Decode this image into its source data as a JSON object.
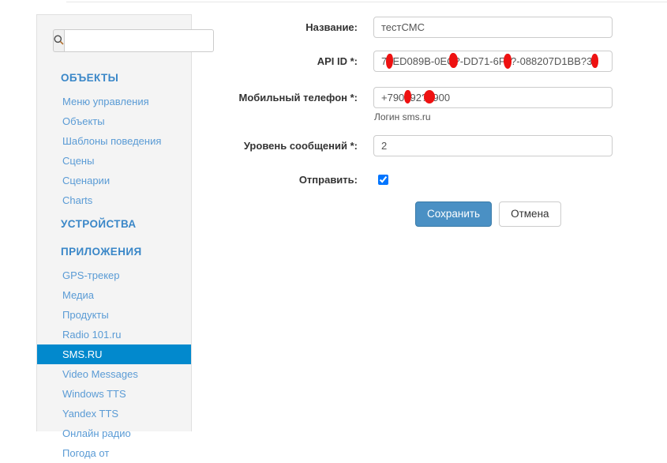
{
  "sidebar": {
    "search": {
      "value": "",
      "placeholder": "",
      "icon": "search-icon"
    },
    "sections": [
      {
        "label": "ОБЪЕКТЫ",
        "items": [
          {
            "label": "Меню управления",
            "active": false
          },
          {
            "label": "Объекты",
            "active": false
          },
          {
            "label": "Шаблоны поведения",
            "active": false
          },
          {
            "label": "Сцены",
            "active": false
          },
          {
            "label": "Сценарии",
            "active": false
          },
          {
            "label": "Charts",
            "active": false
          }
        ]
      },
      {
        "label": "УСТРОЙСТВА",
        "items": []
      },
      {
        "label": "ПРИЛОЖЕНИЯ",
        "items": [
          {
            "label": "GPS-трекер",
            "active": false
          },
          {
            "label": "Медиа",
            "active": false
          },
          {
            "label": "Продукты",
            "active": false
          },
          {
            "label": "Radio 101.ru",
            "active": false
          },
          {
            "label": "SMS.RU",
            "active": true
          },
          {
            "label": "Video Messages",
            "active": false
          },
          {
            "label": "Windows TTS",
            "active": false
          },
          {
            "label": "Yandex TTS",
            "active": false
          },
          {
            "label": "Онлайн радио",
            "active": false
          },
          {
            "label": "Погода от",
            "active": false
          }
        ]
      }
    ]
  },
  "form": {
    "fields": {
      "name": {
        "label": "Название:",
        "value": "тестСМС",
        "placeholder": ""
      },
      "api_id": {
        "label": "API ID *:",
        "value": "7?ED089B-0EC?-DD71-6F9?-088207D1BB?3",
        "placeholder": ""
      },
      "phone": {
        "label": "Мобильный телефон *:",
        "value": "+790?92??900",
        "placeholder": "",
        "help": "Логин sms.ru"
      },
      "level": {
        "label": "Уровень сообщений *:",
        "value": "2",
        "placeholder": ""
      },
      "send": {
        "label": "Отправить:",
        "checked": true
      }
    },
    "buttons": {
      "save": "Сохранить",
      "cancel": "Отмена"
    }
  },
  "colors": {
    "accent_active": "#0289cd",
    "link": "#5a9bd5",
    "section_heading": "#3a87c8",
    "primary_button": "#4a90c4",
    "redaction": "#ee1111",
    "sidebar_bg": "#f4f4f4"
  }
}
